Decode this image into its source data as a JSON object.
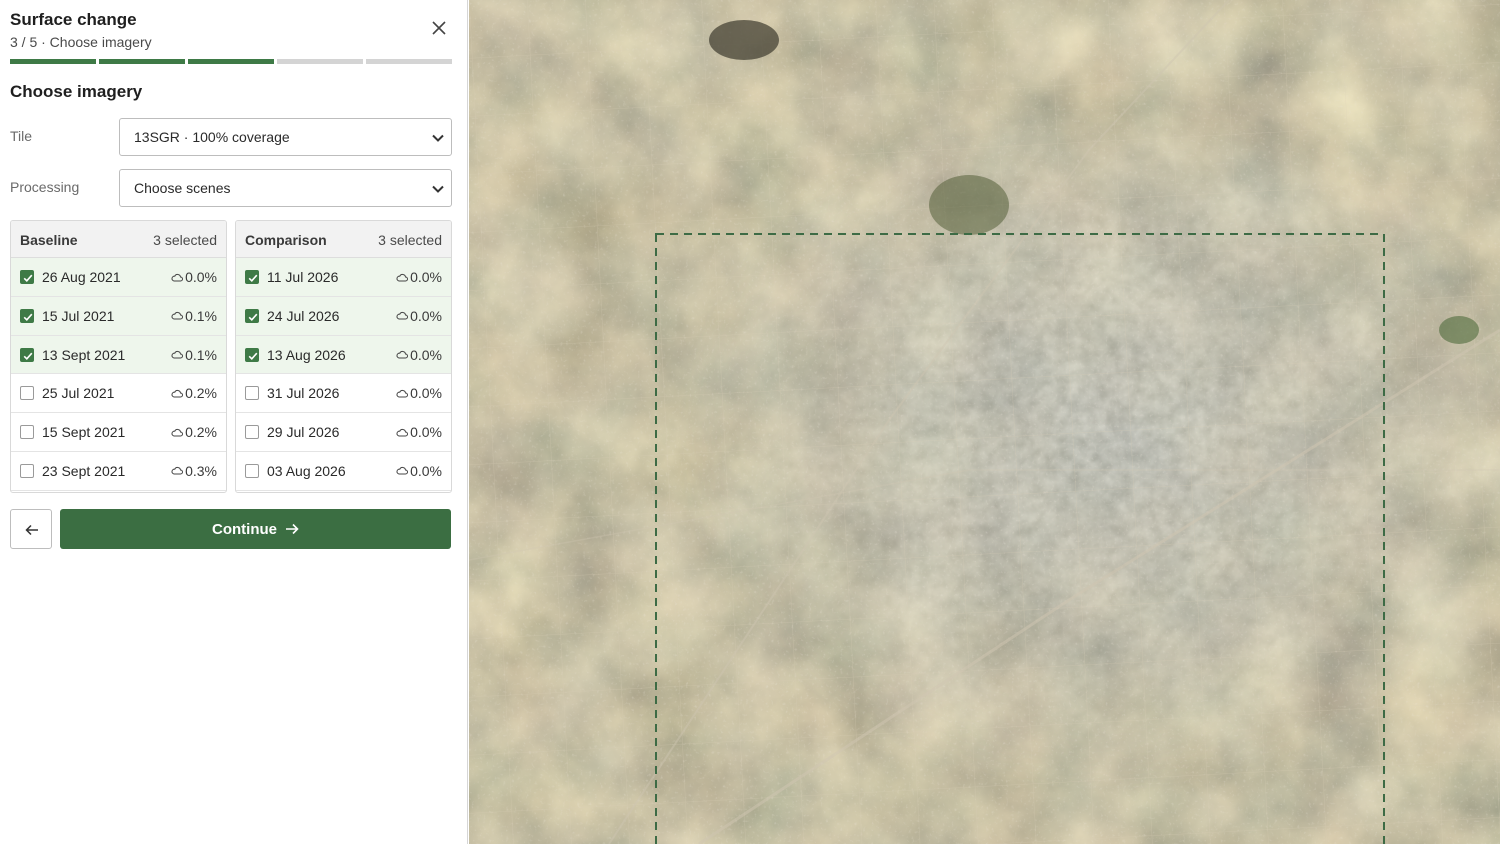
{
  "header": {
    "title": "Surface change",
    "subtitle": "3 / 5 · Choose imagery"
  },
  "progress": {
    "total_steps": 5,
    "completed_steps": 3
  },
  "section": {
    "title": "Choose imagery"
  },
  "fields": {
    "tile": {
      "label": "Tile",
      "value": "13SGR · 100% coverage"
    },
    "processing": {
      "label": "Processing",
      "value": "Choose scenes"
    }
  },
  "baseline": {
    "name": "Baseline",
    "count": "3 selected",
    "scenes": [
      {
        "date": "26 Aug 2021",
        "cloud": "0.0%",
        "selected": true
      },
      {
        "date": "15 Jul 2021",
        "cloud": "0.1%",
        "selected": true
      },
      {
        "date": "13 Sept 2021",
        "cloud": "0.1%",
        "selected": true
      },
      {
        "date": "25 Jul 2021",
        "cloud": "0.2%",
        "selected": false
      },
      {
        "date": "15 Sept 2021",
        "cloud": "0.2%",
        "selected": false
      },
      {
        "date": "23 Sept 2021",
        "cloud": "0.3%",
        "selected": false
      }
    ]
  },
  "comparison": {
    "name": "Comparison",
    "count": "3 selected",
    "scenes": [
      {
        "date": "11 Jul 2026",
        "cloud": "0.0%",
        "selected": true
      },
      {
        "date": "24 Jul 2026",
        "cloud": "0.0%",
        "selected": true
      },
      {
        "date": "13 Aug 2026",
        "cloud": "0.0%",
        "selected": true
      },
      {
        "date": "31 Jul 2026",
        "cloud": "0.0%",
        "selected": false
      },
      {
        "date": "29 Jul 2026",
        "cloud": "0.0%",
        "selected": false
      },
      {
        "date": "03 Aug 2026",
        "cloud": "0.0%",
        "selected": false
      }
    ]
  },
  "actions": {
    "continue_label": "Continue"
  },
  "icons": {
    "close": "close-icon",
    "select": "chevron-down-icon",
    "cloud": "cloud-icon",
    "back": "arrow-left-icon",
    "forward": "arrow-right-icon"
  },
  "colors": {
    "accent": "#3e7a46",
    "button": "#3b6e42",
    "selected_row": "#eef6ec",
    "aoi_outline": "#3d6b45"
  }
}
